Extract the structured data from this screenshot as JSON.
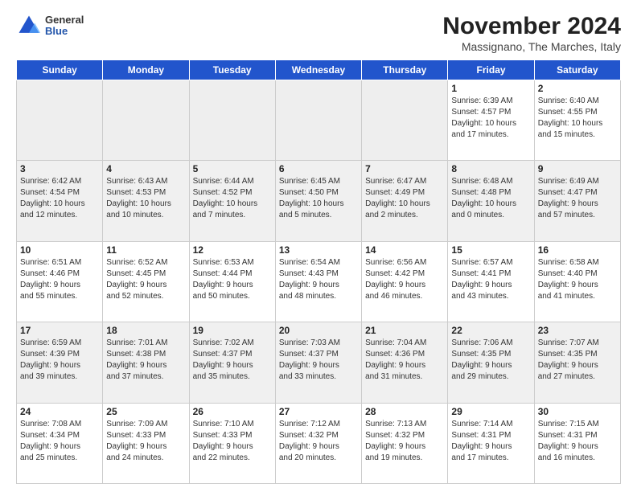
{
  "logo": {
    "general": "General",
    "blue": "Blue"
  },
  "header": {
    "title": "November 2024",
    "location": "Massignano, The Marches, Italy"
  },
  "weekdays": [
    "Sunday",
    "Monday",
    "Tuesday",
    "Wednesday",
    "Thursday",
    "Friday",
    "Saturday"
  ],
  "weeks": [
    [
      {
        "day": "",
        "info": ""
      },
      {
        "day": "",
        "info": ""
      },
      {
        "day": "",
        "info": ""
      },
      {
        "day": "",
        "info": ""
      },
      {
        "day": "",
        "info": ""
      },
      {
        "day": "1",
        "info": "Sunrise: 6:39 AM\nSunset: 4:57 PM\nDaylight: 10 hours\nand 17 minutes."
      },
      {
        "day": "2",
        "info": "Sunrise: 6:40 AM\nSunset: 4:55 PM\nDaylight: 10 hours\nand 15 minutes."
      }
    ],
    [
      {
        "day": "3",
        "info": "Sunrise: 6:42 AM\nSunset: 4:54 PM\nDaylight: 10 hours\nand 12 minutes."
      },
      {
        "day": "4",
        "info": "Sunrise: 6:43 AM\nSunset: 4:53 PM\nDaylight: 10 hours\nand 10 minutes."
      },
      {
        "day": "5",
        "info": "Sunrise: 6:44 AM\nSunset: 4:52 PM\nDaylight: 10 hours\nand 7 minutes."
      },
      {
        "day": "6",
        "info": "Sunrise: 6:45 AM\nSunset: 4:50 PM\nDaylight: 10 hours\nand 5 minutes."
      },
      {
        "day": "7",
        "info": "Sunrise: 6:47 AM\nSunset: 4:49 PM\nDaylight: 10 hours\nand 2 minutes."
      },
      {
        "day": "8",
        "info": "Sunrise: 6:48 AM\nSunset: 4:48 PM\nDaylight: 10 hours\nand 0 minutes."
      },
      {
        "day": "9",
        "info": "Sunrise: 6:49 AM\nSunset: 4:47 PM\nDaylight: 9 hours\nand 57 minutes."
      }
    ],
    [
      {
        "day": "10",
        "info": "Sunrise: 6:51 AM\nSunset: 4:46 PM\nDaylight: 9 hours\nand 55 minutes."
      },
      {
        "day": "11",
        "info": "Sunrise: 6:52 AM\nSunset: 4:45 PM\nDaylight: 9 hours\nand 52 minutes."
      },
      {
        "day": "12",
        "info": "Sunrise: 6:53 AM\nSunset: 4:44 PM\nDaylight: 9 hours\nand 50 minutes."
      },
      {
        "day": "13",
        "info": "Sunrise: 6:54 AM\nSunset: 4:43 PM\nDaylight: 9 hours\nand 48 minutes."
      },
      {
        "day": "14",
        "info": "Sunrise: 6:56 AM\nSunset: 4:42 PM\nDaylight: 9 hours\nand 46 minutes."
      },
      {
        "day": "15",
        "info": "Sunrise: 6:57 AM\nSunset: 4:41 PM\nDaylight: 9 hours\nand 43 minutes."
      },
      {
        "day": "16",
        "info": "Sunrise: 6:58 AM\nSunset: 4:40 PM\nDaylight: 9 hours\nand 41 minutes."
      }
    ],
    [
      {
        "day": "17",
        "info": "Sunrise: 6:59 AM\nSunset: 4:39 PM\nDaylight: 9 hours\nand 39 minutes."
      },
      {
        "day": "18",
        "info": "Sunrise: 7:01 AM\nSunset: 4:38 PM\nDaylight: 9 hours\nand 37 minutes."
      },
      {
        "day": "19",
        "info": "Sunrise: 7:02 AM\nSunset: 4:37 PM\nDaylight: 9 hours\nand 35 minutes."
      },
      {
        "day": "20",
        "info": "Sunrise: 7:03 AM\nSunset: 4:37 PM\nDaylight: 9 hours\nand 33 minutes."
      },
      {
        "day": "21",
        "info": "Sunrise: 7:04 AM\nSunset: 4:36 PM\nDaylight: 9 hours\nand 31 minutes."
      },
      {
        "day": "22",
        "info": "Sunrise: 7:06 AM\nSunset: 4:35 PM\nDaylight: 9 hours\nand 29 minutes."
      },
      {
        "day": "23",
        "info": "Sunrise: 7:07 AM\nSunset: 4:35 PM\nDaylight: 9 hours\nand 27 minutes."
      }
    ],
    [
      {
        "day": "24",
        "info": "Sunrise: 7:08 AM\nSunset: 4:34 PM\nDaylight: 9 hours\nand 25 minutes."
      },
      {
        "day": "25",
        "info": "Sunrise: 7:09 AM\nSunset: 4:33 PM\nDaylight: 9 hours\nand 24 minutes."
      },
      {
        "day": "26",
        "info": "Sunrise: 7:10 AM\nSunset: 4:33 PM\nDaylight: 9 hours\nand 22 minutes."
      },
      {
        "day": "27",
        "info": "Sunrise: 7:12 AM\nSunset: 4:32 PM\nDaylight: 9 hours\nand 20 minutes."
      },
      {
        "day": "28",
        "info": "Sunrise: 7:13 AM\nSunset: 4:32 PM\nDaylight: 9 hours\nand 19 minutes."
      },
      {
        "day": "29",
        "info": "Sunrise: 7:14 AM\nSunset: 4:31 PM\nDaylight: 9 hours\nand 17 minutes."
      },
      {
        "day": "30",
        "info": "Sunrise: 7:15 AM\nSunset: 4:31 PM\nDaylight: 9 hours\nand 16 minutes."
      }
    ]
  ]
}
